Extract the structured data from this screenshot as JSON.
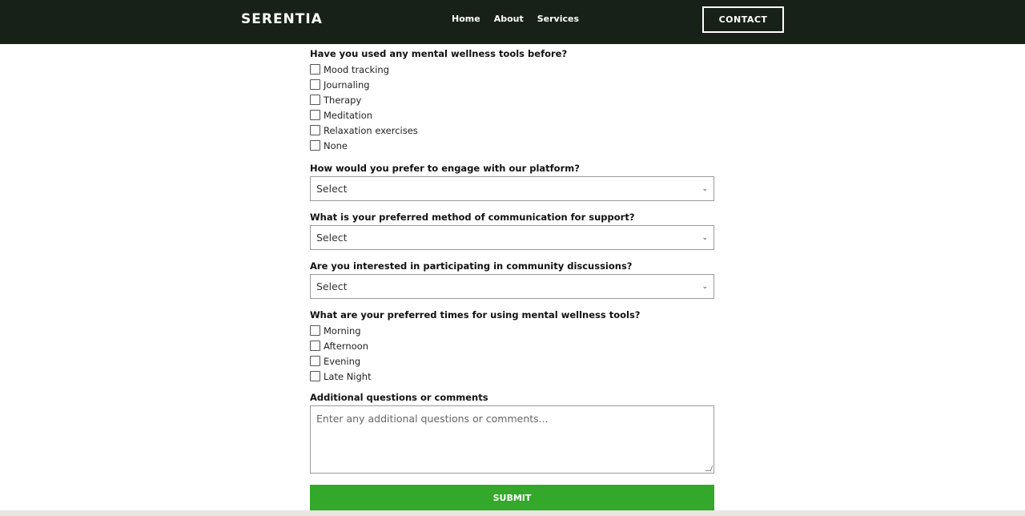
{
  "header": {
    "brand": "SERENTIA",
    "nav": [
      "Home",
      "About",
      "Services"
    ],
    "contact_label": "CONTACT"
  },
  "form": {
    "q_tools": "Have you used any mental wellness tools before?",
    "tools": [
      "Mood tracking",
      "Journaling",
      "Therapy",
      "Meditation",
      "Relaxation exercises",
      "None"
    ],
    "q_engage": "How would you prefer to engage with our platform?",
    "engage_value": "Select",
    "q_comm": "What is your preferred method of communication for support?",
    "comm_value": "Select",
    "q_community": "Are you interested in participating in community discussions?",
    "community_value": "Select",
    "q_times": "What are your preferred times for using mental wellness tools?",
    "times": [
      "Morning",
      "Afternoon",
      "Evening",
      "Late Night"
    ],
    "q_comments": "Additional questions or comments",
    "comments_placeholder": "Enter any additional questions or comments...",
    "submit_label": "SUBMIT"
  },
  "colors": {
    "navbar": "#172118",
    "submit": "#33a82a"
  },
  "icons": {
    "select_chevron": "chevron-down-icon"
  }
}
